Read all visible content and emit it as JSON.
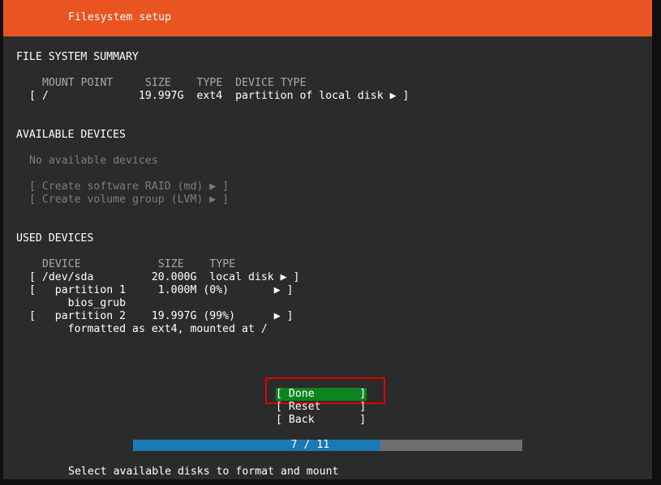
{
  "header": {
    "title": "Filesystem setup"
  },
  "summary": {
    "heading": "FILE SYSTEM SUMMARY",
    "columns_line": "MOUNT POINT     SIZE    TYPE  DEVICE TYPE",
    "rows": [
      "[ /              19.997G  ext4  partition of local disk ▶ ]"
    ]
  },
  "available": {
    "heading": "AVAILABLE DEVICES",
    "empty_text": "No available devices",
    "actions": [
      "[ Create software RAID (md) ▶ ]",
      "[ Create volume group (LVM) ▶ ]"
    ]
  },
  "used": {
    "heading": "USED DEVICES",
    "columns_line": "DEVICE            SIZE    TYPE",
    "rows": [
      "[ /dev/sda         20.000G  local disk ▶ ]",
      "[   partition 1     1.000M (0%)       ▶ ]",
      "      bios_grub",
      "[   partition 2    19.997G (99%)      ▶ ]",
      "      formatted as ext4, mounted at /"
    ]
  },
  "buttons": {
    "done": "[ Done       ]",
    "reset": "[ Reset      ]",
    "back": "[ Back       ]"
  },
  "progress": {
    "text": "7 / 11",
    "current": 7,
    "total": 11
  },
  "status": {
    "text": "Select available disks to format and mount"
  },
  "colors": {
    "header": "#e95420",
    "background": "#2b2b2b",
    "done_button": "#0e8420",
    "progress_fill": "#1a7ab5",
    "focus_outline": "#e00000"
  }
}
